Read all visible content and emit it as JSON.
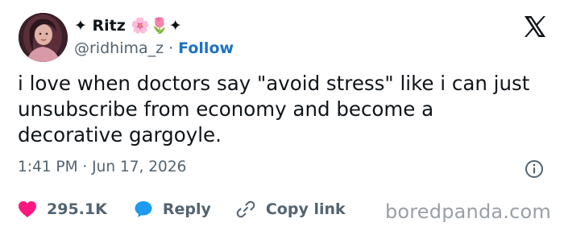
{
  "author": {
    "display_name": "✦ Ritz 🌸🌷✦",
    "handle": "@ridhima_z",
    "separator": "·",
    "follow_label": "Follow"
  },
  "tweet": {
    "text": "i love when doctors say \"avoid stress\" like i can just unsubscribe from economy and become a decorative gargoyle.",
    "timestamp": "1:41 PM · Jun 17, 2026"
  },
  "actions": {
    "likes_count": "295.1K",
    "reply_label": "Reply",
    "copy_link_label": "Copy link"
  },
  "watermark": "boredpanda.com",
  "icons": {
    "like": "heart-icon",
    "reply": "speech-bubble-icon",
    "copy_link": "link-icon",
    "info": "info-icon",
    "brand": "x-logo-icon"
  },
  "colors": {
    "like": "#f91880",
    "reply": "#1d9bf0",
    "follow": "#1d72c4",
    "muted": "#536471",
    "text": "#0f1419",
    "watermark": "#9aa0a6"
  }
}
